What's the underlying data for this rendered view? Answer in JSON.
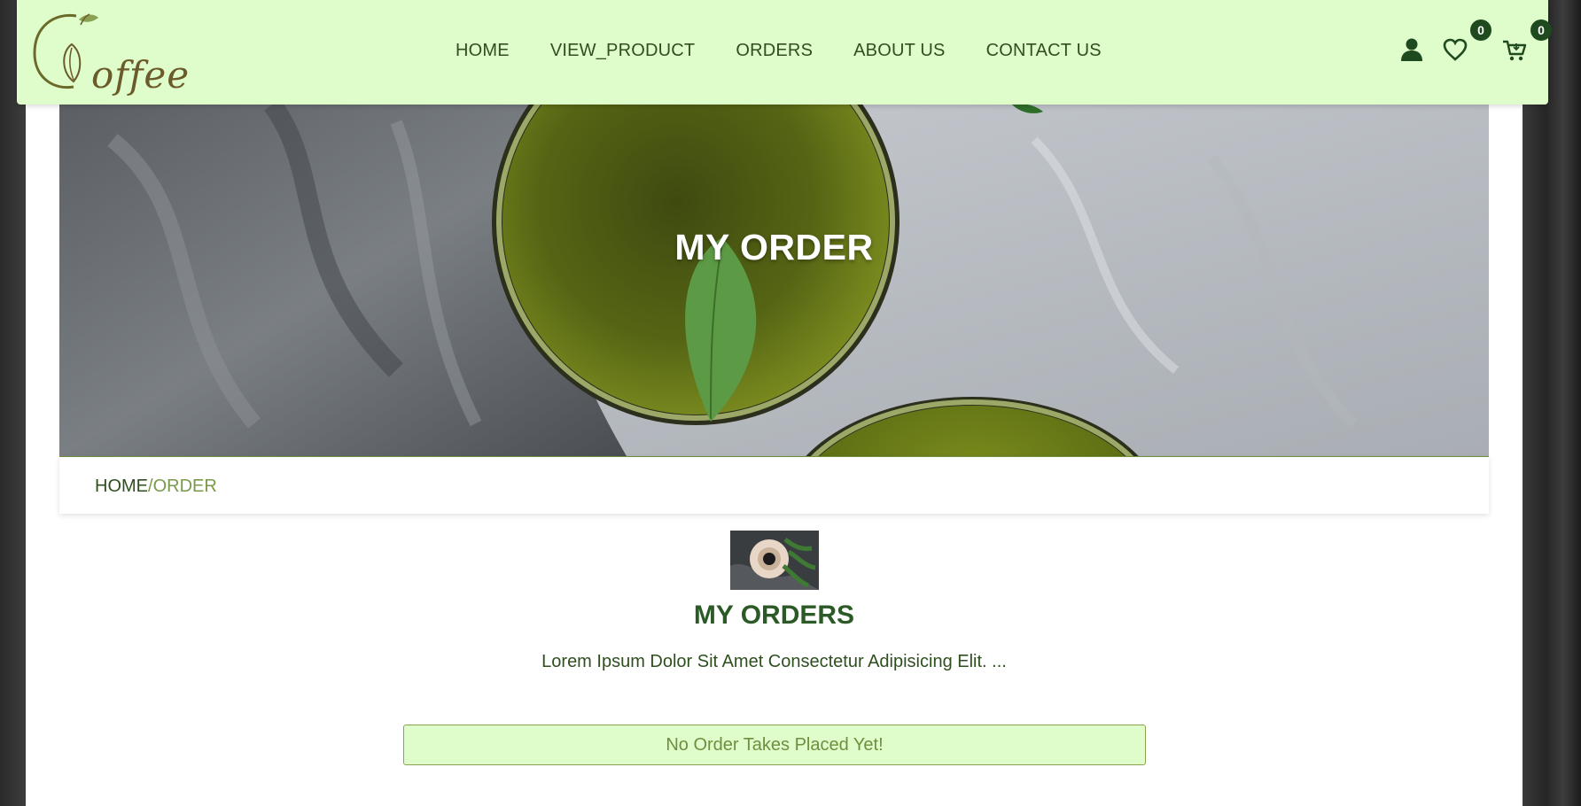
{
  "brand": {
    "logo_text": "offee"
  },
  "nav": {
    "items": [
      {
        "label": "HOME"
      },
      {
        "label": "VIEW_PRODUCT"
      },
      {
        "label": "ORDERS"
      },
      {
        "label": "ABOUT US"
      },
      {
        "label": "CONTACT US"
      }
    ]
  },
  "header_icons": {
    "user_icon": "user-icon",
    "wishlist_icon": "heart-icon",
    "wishlist_count": "0",
    "cart_icon": "cart-icon",
    "cart_count": "0"
  },
  "hero": {
    "title": "MY ORDER"
  },
  "breadcrumb": {
    "home": "HOME",
    "separator": "/",
    "current": "ORDER"
  },
  "section": {
    "title": "MY ORDERS",
    "description": "Lorem Ipsum Dolor Sit Amet Consectetur Adipisicing Elit. ..."
  },
  "empty_state": {
    "message": "No Order Takes Placed Yet!"
  },
  "colors": {
    "header_bg": "#dffccb",
    "primary_dark": "#1f4a1f",
    "accent_green": "#7a9a4a"
  }
}
